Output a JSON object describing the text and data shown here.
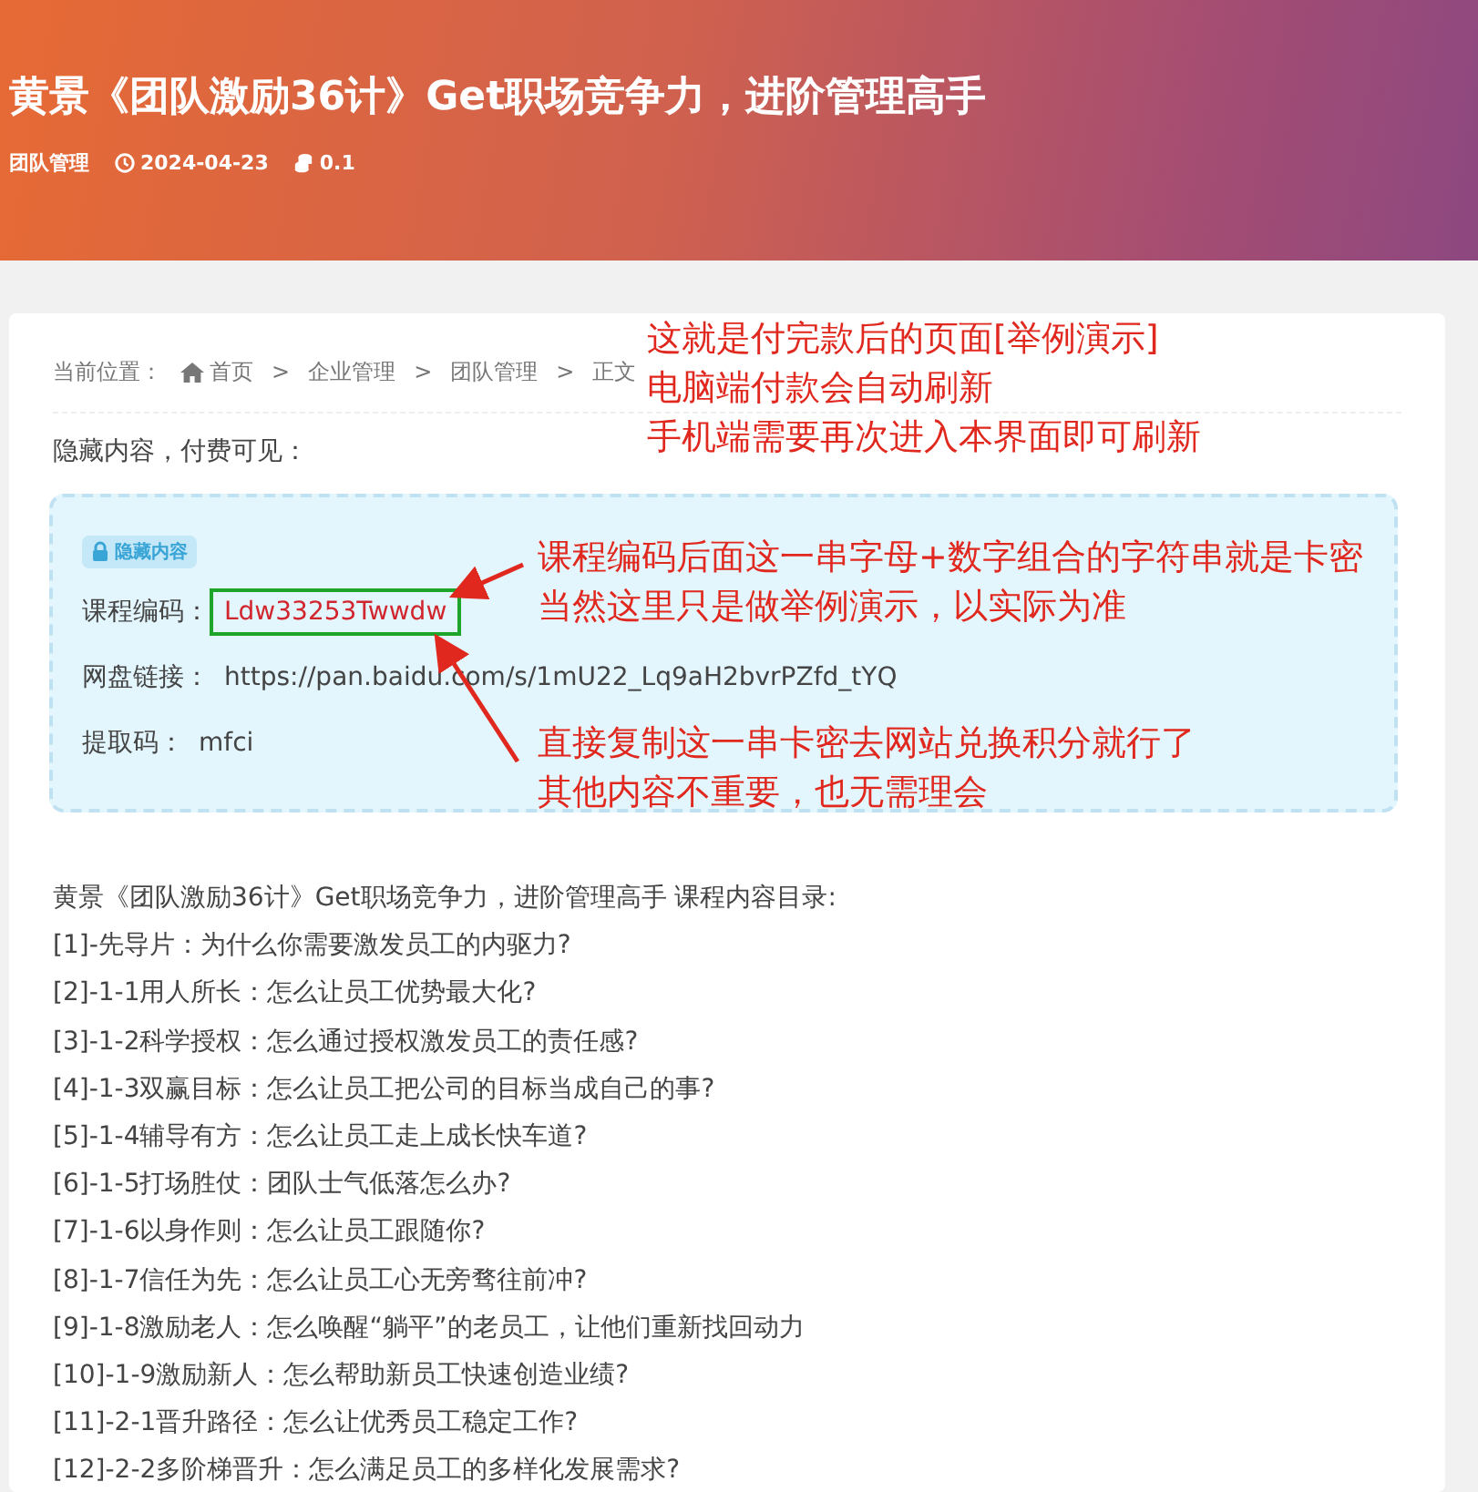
{
  "header": {
    "title": "黄景《团队激励36计》Get职场竞争力，进阶管理高手",
    "category": "团队管理",
    "date": "2024-04-23",
    "price": "0.1"
  },
  "breadcrumb": {
    "label": "当前位置：",
    "separator": ">",
    "items": [
      "首页",
      "企业管理",
      "团队管理",
      "正文"
    ]
  },
  "notice": "隐藏内容，付费可见：",
  "hidden_box": {
    "badge": "隐藏内容",
    "fields": [
      {
        "label": "课程编码：",
        "value": "Ldw33253Twwdw",
        "kind": "code",
        "marked": true
      },
      {
        "label": "网盘链接：",
        "value": "https://pan.baidu.com/s/1mU22_Lq9aH2bvrPZfd_tYQ",
        "kind": "text",
        "marked": false
      },
      {
        "label": "提取码：",
        "value": "mfci",
        "kind": "text",
        "marked": false
      }
    ]
  },
  "annotations": [
    {
      "lines": [
        "这就是付完款后的页面[举例演示]",
        "电脑端付款会自动刷新",
        "手机端需要再次进入本界面即可刷新"
      ]
    },
    {
      "lines": [
        "课程编码后面这一串字母+数字组合的字符串就是卡密",
        "当然这里只是做举例演示，以实际为准"
      ]
    },
    {
      "lines": [
        "直接复制这一串卡密去网站兑换积分就行了",
        "其他内容不重要，也无需理会"
      ]
    }
  ],
  "toc": {
    "heading": "黄景《团队激励36计》Get职场竞争力，进阶管理高手 课程内容目录:",
    "items": [
      "[1]-先导片：为什么你需要激发员工的内驱力?",
      "[2]-1-1用人所长：怎么让员工优势最大化?",
      "[3]-1-2科学授权：怎么通过授权激发员工的责任感?",
      "[4]-1-3双赢目标：怎么让员工把公司的目标当成自己的事?",
      "[5]-1-4辅导有方：怎么让员工走上成长快车道?",
      "[6]-1-5打场胜仗：团队士气低落怎么办?",
      "[7]-1-6以身作则：怎么让员工跟随你?",
      "[8]-1-7信任为先：怎么让员工心无旁骛往前冲?",
      "[9]-1-8激励老人：怎么唤醒“躺平”的老员工，让他们重新找回动力",
      "[10]-1-9激励新人：怎么帮助新员工快速创造业绩?",
      "[11]-2-1晋升路径：怎么让优秀员工稳定工作?",
      "[12]-2-2多阶梯晋升：怎么满足员工的多样化发展需求?"
    ]
  }
}
